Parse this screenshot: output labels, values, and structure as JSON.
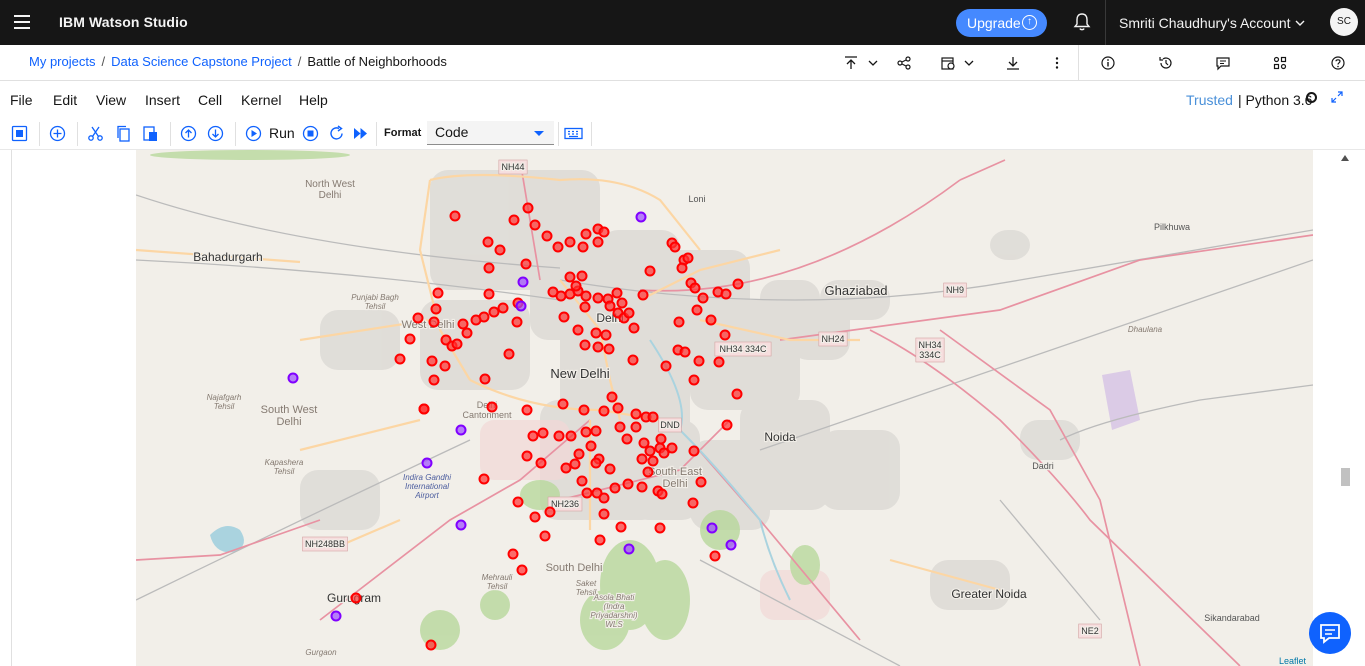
{
  "topbar": {
    "brand": "IBM Watson Studio",
    "upgrade_label": "Upgrade",
    "account": "Smriti Chaudhury's Account",
    "avatar_initials": "SC"
  },
  "breadcrumb": {
    "items": [
      "My projects",
      "Data Science Capstone Project"
    ],
    "current": "Battle of Neighborhoods",
    "separator": "/"
  },
  "menu": [
    "File",
    "Edit",
    "View",
    "Insert",
    "Cell",
    "Kernel",
    "Help"
  ],
  "kernel_status": {
    "trusted": "Trusted",
    "separator": "|",
    "kernel": "Python 3.6"
  },
  "toolbar": {
    "run_label": "Run",
    "format_label": "Format",
    "format_value": "Code"
  },
  "map": {
    "labels": [
      "North West Delhi",
      "Bahadurgarh",
      "Punjabi Bagh Tehsil",
      "West Delhi",
      "Delhi",
      "New Delhi",
      "Loni",
      "Ghaziabad",
      "Pilkhuwa",
      "Dhaulana",
      "Noida",
      "Dadri",
      "Greater Noida",
      "Sikandarabad",
      "South West Delhi",
      "Najafgarh Tehsil",
      "Kapashera Tehsil",
      "Indira Gandhi International Airport",
      "Gurugram",
      "Gurgaon",
      "Mehrauli Tehsil",
      "South Delhi",
      "Saket Tehsil",
      "Asola Bhati (Indra Priyadarshni) WLS",
      "Delhi Cantonment",
      "South East Delhi",
      "DND",
      "NH44",
      "NH9",
      "NH24",
      "NH 9",
      "NH34 334C",
      "NH236",
      "NH248BB",
      "NE2"
    ],
    "attribution": "Leaflet",
    "colors": {
      "cluster_red": "#ff0000",
      "cluster_purple": "#8000ff",
      "land": "#f2efe9"
    }
  }
}
